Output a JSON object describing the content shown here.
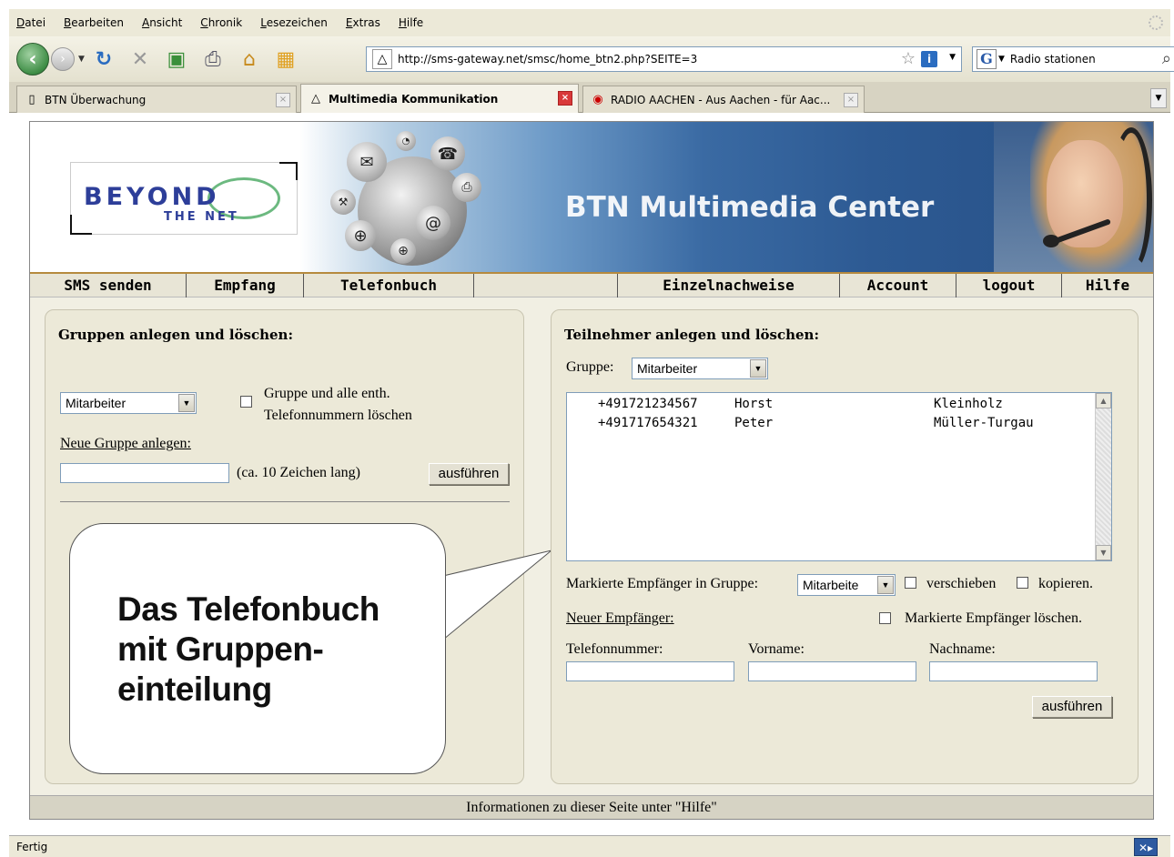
{
  "browser": {
    "menu": [
      "Datei",
      "Bearbeiten",
      "Ansicht",
      "Chronik",
      "Lesezeichen",
      "Extras",
      "Hilfe"
    ],
    "url": "http://sms-gateway.net/smsc/home_btn2.php?SEITE=3",
    "search_text": "Radio stationen",
    "search_engine_letter": "G",
    "tabs": [
      {
        "label": "BTN Überwachung"
      },
      {
        "label": "Multimedia Kommunikation"
      },
      {
        "label": "RADIO AACHEN - Aus Aachen - für Aac..."
      }
    ],
    "status": "Fertig"
  },
  "site": {
    "logo_line1": "BEYOND",
    "logo_line2": "THE NET",
    "title": "BTN Multimedia Center",
    "nav": [
      "SMS senden",
      "Empfang",
      "Telefonbuch",
      "Einzelnachweise",
      "Account",
      "logout",
      "Hilfe"
    ],
    "footer": "Informationen zu dieser Seite unter \"Hilfe\""
  },
  "groups": {
    "heading": "Gruppen anlegen und löschen:",
    "selected_group": "Mitarbeiter",
    "delete_label_line1": "Gruppe und alle enth.",
    "delete_label_line2": "Telefonnummern löschen",
    "new_group_label": "Neue Gruppe anlegen:",
    "new_group_value": "",
    "length_hint": "(ca. 10 Zeichen lang)",
    "submit": "ausführen"
  },
  "callout": {
    "line1": "Das Telefonbuch",
    "line2": "mit Gruppen-",
    "line3": "einteilung"
  },
  "members": {
    "heading": "Teilnehmer anlegen und löschen:",
    "group_label": "Gruppe:",
    "selected_group": "Mitarbeiter",
    "entries": [
      {
        "number": "+491721234567",
        "first": "Horst",
        "last": "Kleinholz"
      },
      {
        "number": "+491717654321",
        "first": "Peter",
        "last": "Müller-Turgau"
      }
    ],
    "marked_in_group_label": "Markierte Empfänger in Gruppe:",
    "target_group": "Mitarbeite",
    "move_label": "verschieben",
    "copy_label": "kopieren.",
    "new_recipient_label": "Neuer Empfänger:",
    "delete_marked_label": "Markierte Empfänger löschen.",
    "phone_label": "Telefonnummer:",
    "firstname_label": "Vorname:",
    "lastname_label": "Nachname:",
    "phone_value": "",
    "firstname_value": "",
    "lastname_value": "",
    "submit": "ausführen"
  },
  "colors": {
    "banner_blue": "#2d5a93",
    "nav_accent": "#b68a3e",
    "panel_bg": "#ece9d8"
  }
}
